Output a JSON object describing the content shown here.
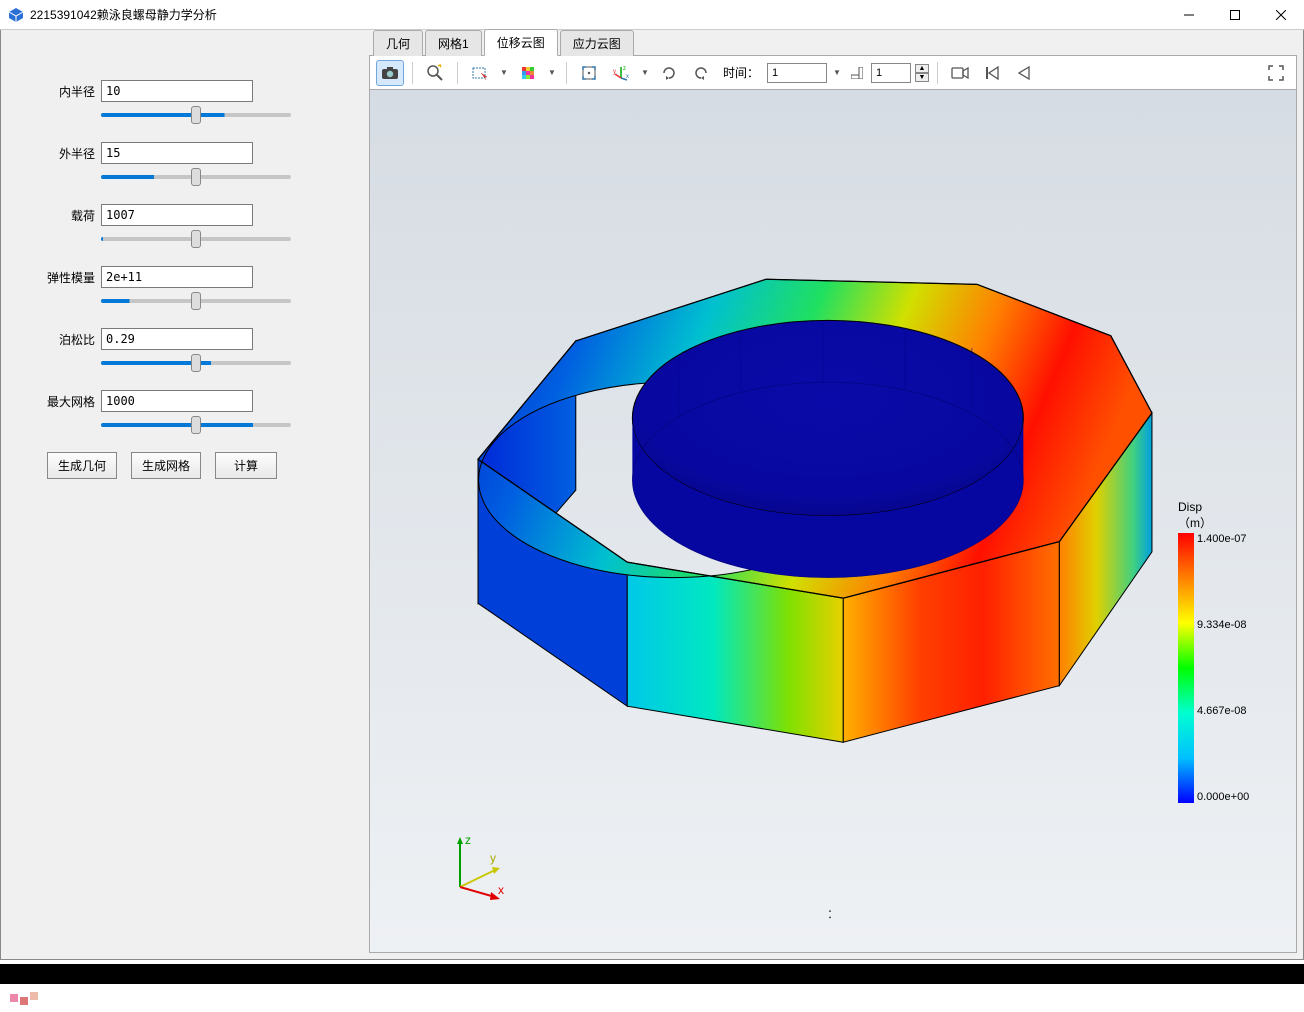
{
  "window": {
    "title": "2215391042赖泳良螺母静力学分析"
  },
  "params": {
    "inner_radius": {
      "label": "内半径",
      "value": "10",
      "pct": 65
    },
    "outer_radius": {
      "label": "外半径",
      "value": "15",
      "pct": 28
    },
    "load": {
      "label": "载荷",
      "value": "1007",
      "pct": 1
    },
    "modulus": {
      "label": "弹性模量",
      "value": "2e+11",
      "pct": 15
    },
    "poisson": {
      "label": "泊松比",
      "value": "0.29",
      "pct": 58
    },
    "max_mesh": {
      "label": "最大网格",
      "value": "1000",
      "pct": 80
    }
  },
  "buttons": {
    "gen_geom": "生成几何",
    "gen_mesh": "生成网格",
    "compute": "计算"
  },
  "tabs": {
    "geometry": "几何",
    "mesh": "网格1",
    "disp_cloud": "位移云图",
    "stress_cloud": "应力云图",
    "active": "disp_cloud"
  },
  "toolbar": {
    "time_label": "时间：",
    "time_value": "1",
    "step_value": "1"
  },
  "legend": {
    "title1": "Disp",
    "title2": "（m）",
    "max": "1.400e-07",
    "mid2": "9.334e-08",
    "mid1": "4.667e-08",
    "min": "0.000e+00"
  },
  "axes": {
    "x": "x",
    "y": "y",
    "z": "z"
  },
  "footer_colon": "："
}
